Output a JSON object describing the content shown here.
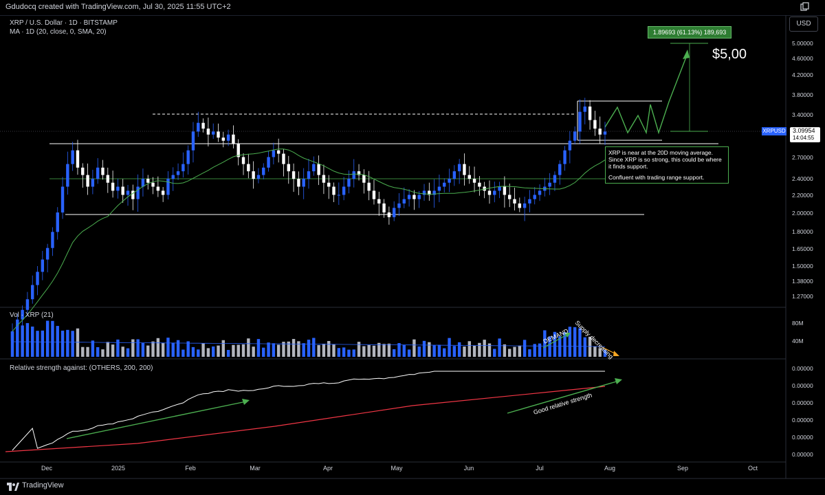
{
  "header": {
    "attribution": "Gdudocq created with TradingView.com, Jul 30, 2025 11:55 UTC+2"
  },
  "legend": {
    "symbol": "XRP / U.S. Dollar · 1D · BITSTAMP",
    "ma": "MA · 1D (20, close, 0, SMA, 20)",
    "volume": "Vol · XRP (21)",
    "relative_strength": "Relative strength against: (OTHERS, 200, 200)"
  },
  "currency_button": "USD",
  "price_tag": {
    "price": "3.09954",
    "countdown": "14:04:55",
    "symbol": "XRPUSD"
  },
  "target_box": "1.89693 (61.13%) 189,693",
  "target_label": "$5,00",
  "note": {
    "line1": "XRP is near at the 20D moving average. Since XRP is so strong, this could be where it finds support.",
    "line2": "Confluent with trading range support."
  },
  "annotations": {
    "demand": "DEMAND",
    "supply": "Supply decreasing",
    "good_rs": "Good relative strength"
  },
  "footer": {
    "brand": "TradingView"
  },
  "colors": {
    "candle": "#2962ff",
    "candle_light": "#ffffff",
    "ma": "#4caf50",
    "rs": "#ffffff",
    "rs_ma": "#f23645",
    "projection": "#4caf50",
    "volume": "#2962ff"
  },
  "chart_data": {
    "type": "candlestick",
    "x_labels": [
      "Dec",
      "2025",
      "Feb",
      "Mar",
      "Apr",
      "May",
      "Jun",
      "Jul",
      "Aug",
      "Sep",
      "Oct"
    ],
    "price_ticks": [
      "5.00000",
      "4.60000",
      "4.20000",
      "3.80000",
      "3.40000",
      "3.00000",
      "2.70000",
      "2.40000",
      "2.20000",
      "2.00000",
      "1.80000",
      "1.65000",
      "1.50000",
      "1.38000",
      "1.27000"
    ],
    "volume_ticks": [
      "80M",
      "40M"
    ],
    "rs_ticks": [
      "0.00000",
      "0.00000",
      "0.00000",
      "0.00000",
      "0.00000",
      "0.00000"
    ],
    "scale": "log",
    "levels": {
      "range_top": 2.95,
      "range_mid": 2.4,
      "range_bottom": 1.98,
      "ath_dashed": 3.4,
      "box_top": 3.65,
      "box_bottom": 2.98
    },
    "target": 5.0,
    "last_price": 3.09954,
    "series": [
      {
        "name": "XRP / U.S. Dollar",
        "close": [
          1.05,
          1.12,
          1.18,
          1.25,
          1.35,
          1.45,
          1.55,
          1.65,
          1.8,
          2.0,
          2.3,
          2.6,
          2.8,
          2.55,
          2.45,
          2.3,
          2.4,
          2.55,
          2.45,
          2.35,
          2.25,
          2.3,
          2.2,
          2.25,
          2.15,
          2.3,
          2.4,
          2.35,
          2.3,
          2.25,
          2.2,
          2.4,
          2.45,
          2.5,
          2.6,
          2.8,
          3.1,
          3.25,
          3.15,
          3.05,
          3.1,
          3.0,
          2.95,
          3.05,
          2.9,
          2.7,
          2.6,
          2.5,
          2.4,
          2.45,
          2.55,
          2.7,
          2.8,
          2.75,
          2.6,
          2.5,
          2.4,
          2.3,
          2.4,
          2.5,
          2.6,
          2.45,
          2.35,
          2.3,
          2.2,
          2.2,
          2.3,
          2.4,
          2.5,
          2.45,
          2.35,
          2.25,
          2.15,
          2.1,
          2.0,
          1.95,
          2.05,
          2.1,
          2.15,
          2.2,
          2.15,
          2.2,
          2.25,
          2.2,
          2.25,
          2.3,
          2.35,
          2.4,
          2.5,
          2.6,
          2.45,
          2.4,
          2.35,
          2.3,
          2.25,
          2.2,
          2.25,
          2.3,
          2.2,
          2.15,
          2.1,
          2.05,
          2.1,
          2.15,
          2.2,
          2.25,
          2.3,
          2.35,
          2.45,
          2.6,
          2.8,
          2.95,
          3.1,
          3.45,
          3.55,
          3.3,
          3.15,
          3.05,
          3.1
        ]
      },
      {
        "name": "MA 20"
      },
      {
        "name": "Relative strength"
      }
    ]
  }
}
